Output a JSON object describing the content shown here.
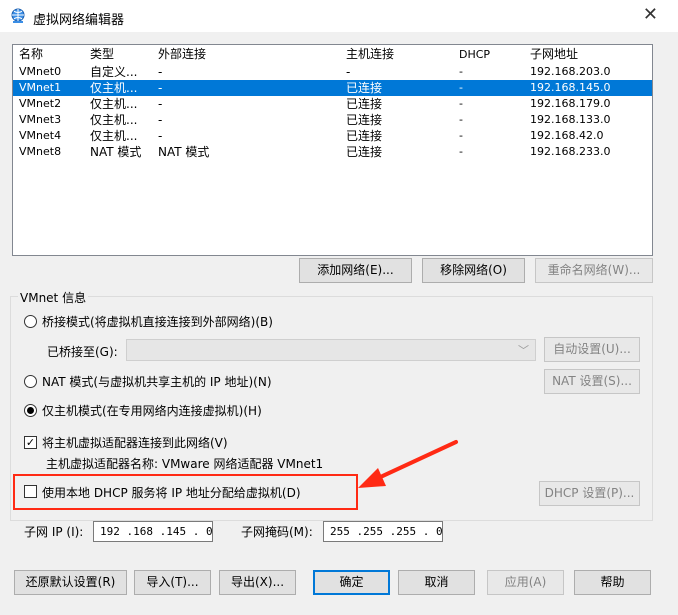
{
  "window": {
    "title": "虚拟网络编辑器",
    "close": "✕"
  },
  "table": {
    "columns": [
      "名称",
      "类型",
      "外部连接",
      "主机连接",
      "DHCP",
      "子网地址"
    ],
    "rows": [
      {
        "name": "VMnet0",
        "type": "自定义...",
        "external": "-",
        "host": "-",
        "dhcp": "-",
        "subnet": "192.168.203.0",
        "selected": false
      },
      {
        "name": "VMnet1",
        "type": "仅主机...",
        "external": "-",
        "host": "已连接",
        "dhcp": "-",
        "subnet": "192.168.145.0",
        "selected": true
      },
      {
        "name": "VMnet2",
        "type": "仅主机...",
        "external": "-",
        "host": "已连接",
        "dhcp": "-",
        "subnet": "192.168.179.0",
        "selected": false
      },
      {
        "name": "VMnet3",
        "type": "仅主机...",
        "external": "-",
        "host": "已连接",
        "dhcp": "-",
        "subnet": "192.168.133.0",
        "selected": false
      },
      {
        "name": "VMnet4",
        "type": "仅主机...",
        "external": "-",
        "host": "已连接",
        "dhcp": "-",
        "subnet": "192.168.42.0",
        "selected": false
      },
      {
        "name": "VMnet8",
        "type": "NAT 模式",
        "external": "NAT 模式",
        "host": "已连接",
        "dhcp": "-",
        "subnet": "192.168.233.0",
        "selected": false
      }
    ]
  },
  "actions": {
    "add": "添加网络(E)...",
    "remove": "移除网络(O)",
    "rename": "重命名网络(W)..."
  },
  "vmnet_info": {
    "title": "VMnet 信息",
    "bridged": "桥接模式(将虚拟机直接连接到外部网络)(B)",
    "bridged_to": "已桥接至(G):",
    "auto_settings": "自动设置(U)...",
    "nat": "NAT 模式(与虚拟机共享主机的 IP 地址)(N)",
    "nat_settings": "NAT 设置(S)...",
    "host_only": "仅主机模式(在专用网络内连接虚拟机)(H)",
    "connect_adapter": "将主机虚拟适配器连接到此网络(V)",
    "adapter_name": "主机虚拟适配器名称: VMware 网络适配器 VMnet1",
    "use_dhcp": "使用本地 DHCP 服务将 IP 地址分配给虚拟机(D)",
    "dhcp_settings": "DHCP 设置(P)...",
    "subnet_ip_label": "子网 IP (I):",
    "subnet_ip": "192 .168 .145 .  0",
    "subnet_mask_label": "子网掩码(M):",
    "subnet_mask": "255 .255 .255 .  0"
  },
  "footer": {
    "restore": "还原默认设置(R)",
    "import": "导入(T)...",
    "export": "导出(X)...",
    "ok": "确定",
    "cancel": "取消",
    "apply": "应用(A)",
    "help": "帮助"
  },
  "colors": {
    "selection": "#0078d7",
    "highlight_box": "#ff2a14"
  }
}
